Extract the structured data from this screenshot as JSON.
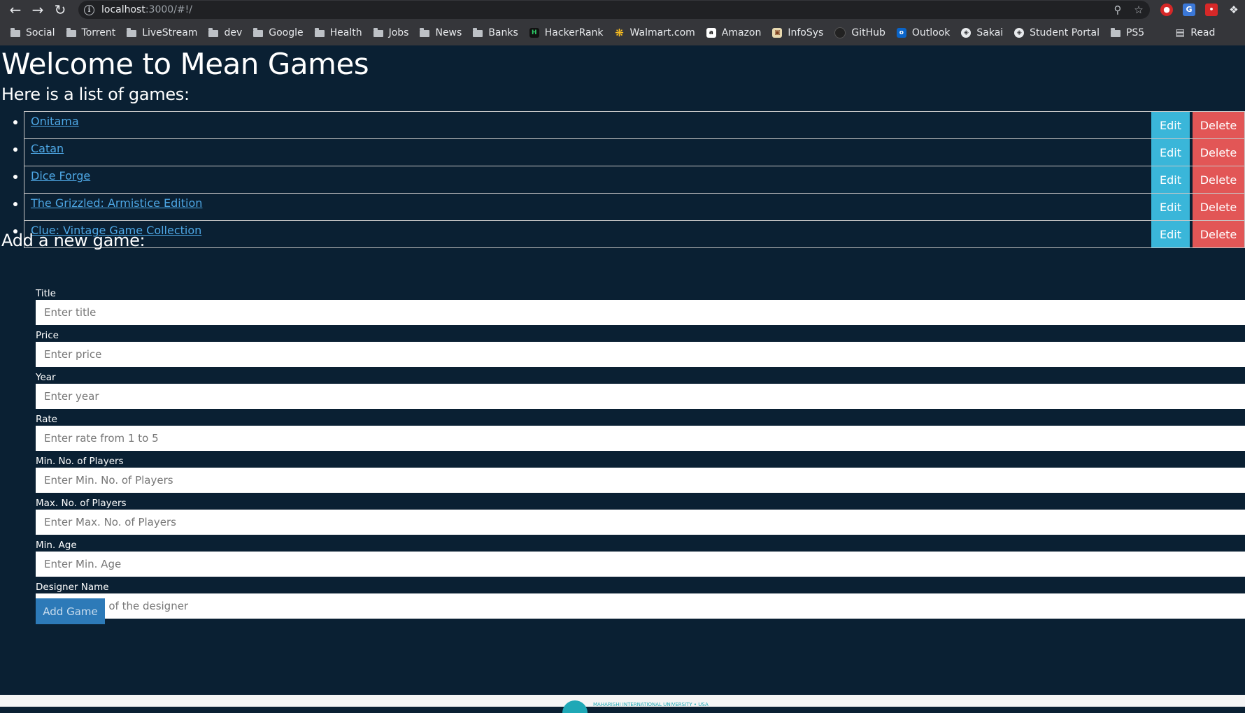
{
  "browser": {
    "url_host": "localhost",
    "url_rest": ":3000/#!/",
    "bookmarks": [
      {
        "label": "Social",
        "type": "folder"
      },
      {
        "label": "Torrent",
        "type": "folder"
      },
      {
        "label": "LiveStream",
        "type": "folder"
      },
      {
        "label": "dev",
        "type": "folder"
      },
      {
        "label": "Google",
        "type": "folder"
      },
      {
        "label": "Health",
        "type": "folder"
      },
      {
        "label": "Jobs",
        "type": "folder"
      },
      {
        "label": "News",
        "type": "folder"
      },
      {
        "label": "Banks",
        "type": "folder"
      },
      {
        "label": "HackerRank",
        "type": "site"
      },
      {
        "label": "Walmart.com",
        "type": "site"
      },
      {
        "label": "Amazon",
        "type": "site"
      },
      {
        "label": "InfoSys",
        "type": "site"
      },
      {
        "label": "GitHub",
        "type": "site"
      },
      {
        "label": "Outlook",
        "type": "site"
      },
      {
        "label": "Sakai",
        "type": "site"
      },
      {
        "label": "Student Portal",
        "type": "site"
      },
      {
        "label": "PS5",
        "type": "folder"
      },
      {
        "label": "Read",
        "type": "site"
      }
    ]
  },
  "page": {
    "title": "Welcome to Mean Games",
    "list_heading": "Here is a list of games:",
    "add_heading": "Add a new game:",
    "edit_label": "Edit",
    "delete_label": "Delete",
    "games": [
      "Onitama",
      "Catan",
      "Dice Forge",
      "The Grizzled: Armistice Edition",
      "Clue: Vintage Game Collection"
    ]
  },
  "form": {
    "fields": [
      {
        "label": "Title",
        "placeholder": "Enter title"
      },
      {
        "label": "Price",
        "placeholder": "Enter price"
      },
      {
        "label": "Year",
        "placeholder": "Enter year"
      },
      {
        "label": "Rate",
        "placeholder": "Enter rate from 1 to 5"
      },
      {
        "label": "Min. No. of Players",
        "placeholder": "Enter Min. No. of Players"
      },
      {
        "label": "Max. No. of Players",
        "placeholder": "Enter Max. No. of Players"
      },
      {
        "label": "Min. Age",
        "placeholder": "Enter Min. Age"
      },
      {
        "label": "Designer Name",
        "placeholder": "Enter name of the designer"
      }
    ],
    "submit_label": "Add Game"
  },
  "footer": {
    "text": "MAHARISHI INTERNATIONAL UNIVERSITY • USA"
  }
}
